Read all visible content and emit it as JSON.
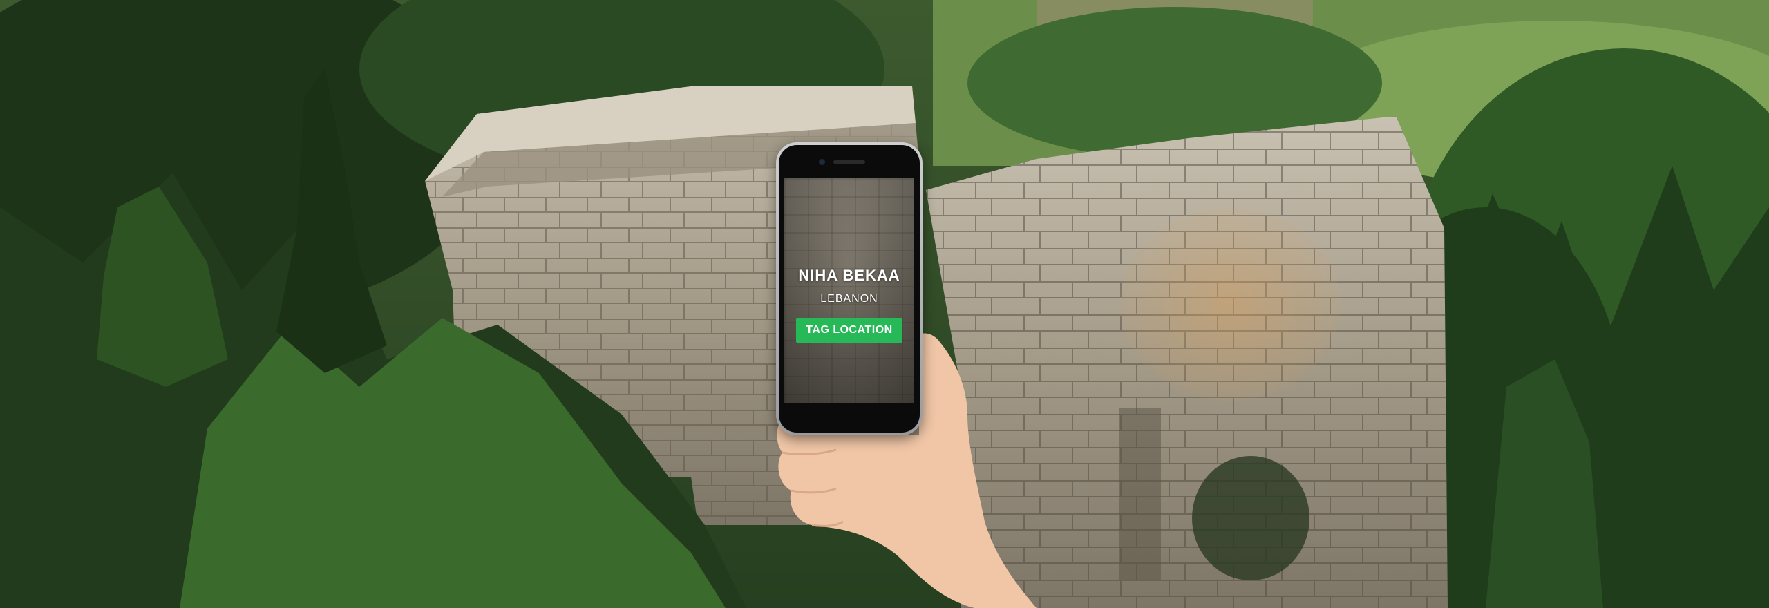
{
  "phone": {
    "screen": {
      "place_name": "NIHA BEKAA",
      "country": "LEBANON",
      "tag_button_label": "TAG LOCATION"
    }
  },
  "colors": {
    "tag_button": "#27b858",
    "forest_dark": "#1f3a1c",
    "stone": "#a89f8e"
  },
  "scene": {
    "subject": "ancient stone temple ruins",
    "foreground_item": "hand holding smartphone"
  }
}
